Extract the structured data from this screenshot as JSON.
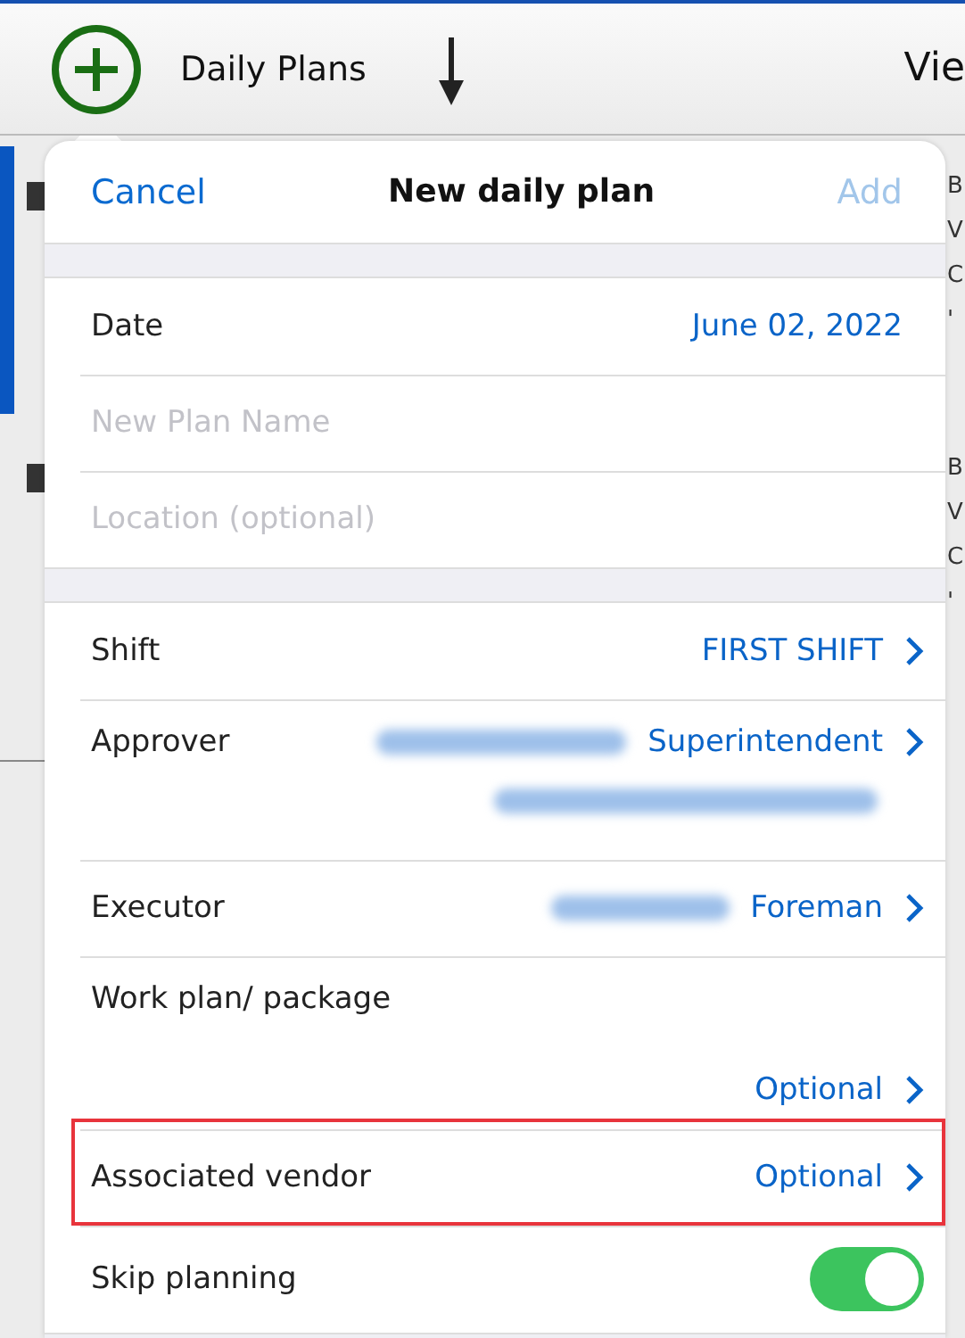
{
  "toolbar": {
    "title": "Daily Plans",
    "view_label": "Vie"
  },
  "background_rows": [
    {
      "selected": true,
      "lines": [
        "B",
        "V",
        "C",
        "'"
      ]
    },
    {
      "selected": false,
      "lines": [
        "B",
        "V",
        "C",
        "'"
      ]
    }
  ],
  "popover": {
    "cancel": "Cancel",
    "title": "New daily plan",
    "add": {
      "label": "Add",
      "disabled": true
    },
    "groups": [
      [
        {
          "kind": "value",
          "label": "Date",
          "value": "June 02, 2022"
        },
        {
          "kind": "input",
          "placeholder": "New Plan Name"
        },
        {
          "kind": "input",
          "placeholder": "Location (optional)"
        }
      ],
      [
        {
          "kind": "link",
          "label": "Shift",
          "value": "FIRST SHIFT",
          "highlighted": false
        },
        {
          "kind": "link",
          "label": "Approver",
          "value": "Superintendent",
          "blurred_name": true,
          "blurred_subline": true,
          "highlighted": false
        },
        {
          "kind": "link",
          "label": "Executor",
          "value": "Foreman",
          "blurred_name": true,
          "highlighted": false
        },
        {
          "kind": "stacked",
          "label": "Work plan/ package",
          "value": "Optional",
          "highlighted": false
        },
        {
          "kind": "link",
          "label": "Associated vendor",
          "value": "Optional",
          "highlighted": true
        },
        {
          "kind": "toggle",
          "label": "Skip planning",
          "on": true
        }
      ]
    ]
  }
}
